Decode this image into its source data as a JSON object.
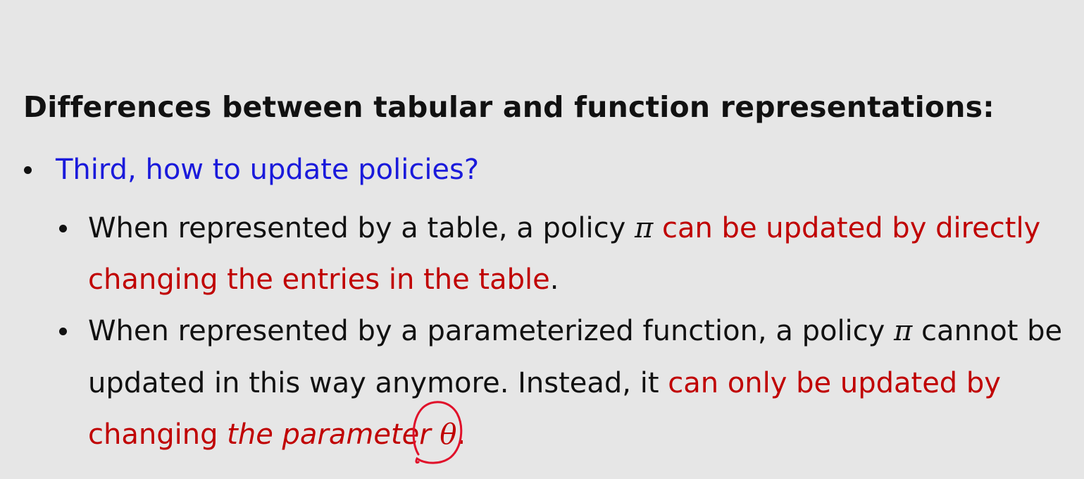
{
  "heading": "Differences between tabular and function representations:",
  "bullet1": {
    "text": "Third, how to update policies?"
  },
  "sub1": {
    "line1_black": "When represented by a table, a policy ",
    "line1_pi": "π",
    "line1_red": " can be updated by directly",
    "line2_red": "changing the entries in the table",
    "line2_black": "."
  },
  "sub2": {
    "line1_black_a": "When represented by a parameterized function, a policy ",
    "line1_pi": "π",
    "line1_black_b": " cannot be",
    "line2_black": "updated in this way anymore. Instead, it ",
    "line2_red": "can only be updated by",
    "line3_red": "changing ",
    "line3_red_italic": "the parameter ",
    "line3_theta": "θ",
    "line3_period": "."
  },
  "colors": {
    "background": "#e6e6e6",
    "text": "#111111",
    "blue": "#1a1adb",
    "red": "#c00000",
    "annotation": "#e0102a"
  }
}
